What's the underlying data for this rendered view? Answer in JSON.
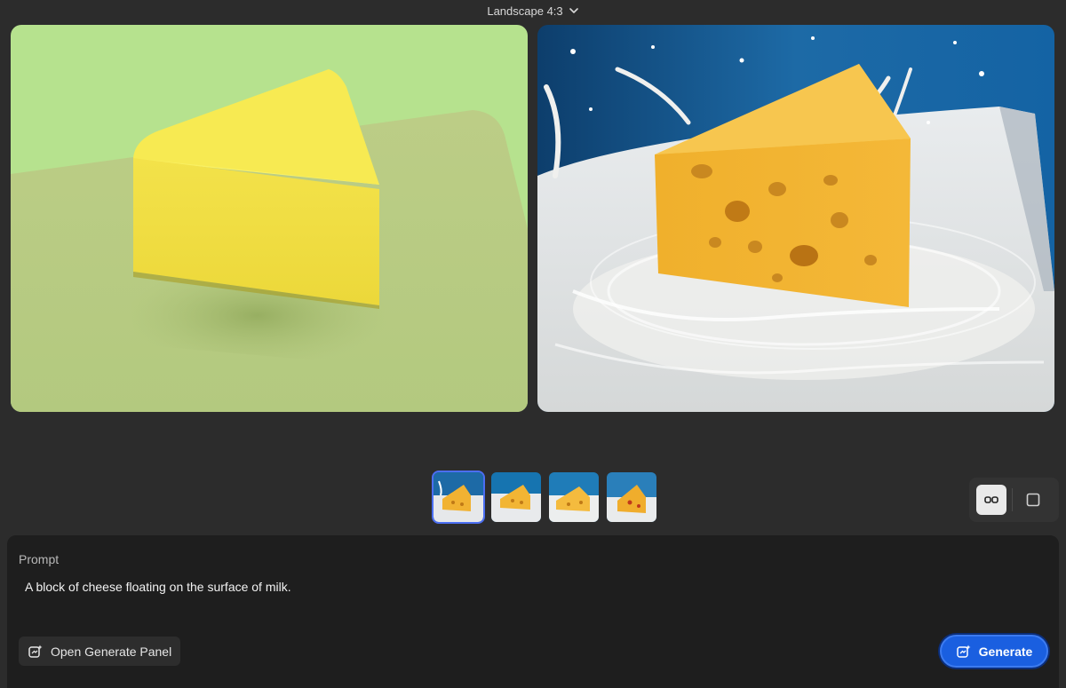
{
  "header": {
    "aspect_label": "Landscape 4:3",
    "aspect_icon": "chevron-down-icon"
  },
  "canvases": {
    "left": {
      "description_icon": "cheese-render-image"
    },
    "right": {
      "description_icon": "cheese-photo-image"
    }
  },
  "thumbnails": {
    "count": 4,
    "selected_index": 0
  },
  "view_toggle": {
    "compare_icon": "compare-view-icon",
    "single_icon": "single-view-icon",
    "active": "compare"
  },
  "prompt": {
    "label": "Prompt",
    "text": "A block of cheese floating on the surface of milk."
  },
  "actions": {
    "open_panel_label": "Open Generate Panel",
    "generate_label": "Generate"
  },
  "colors": {
    "background": "#2c2c2c",
    "panel": "#1e1e1e",
    "accent": "#1a5fe0",
    "selected_outline": "#4b6ef2"
  }
}
